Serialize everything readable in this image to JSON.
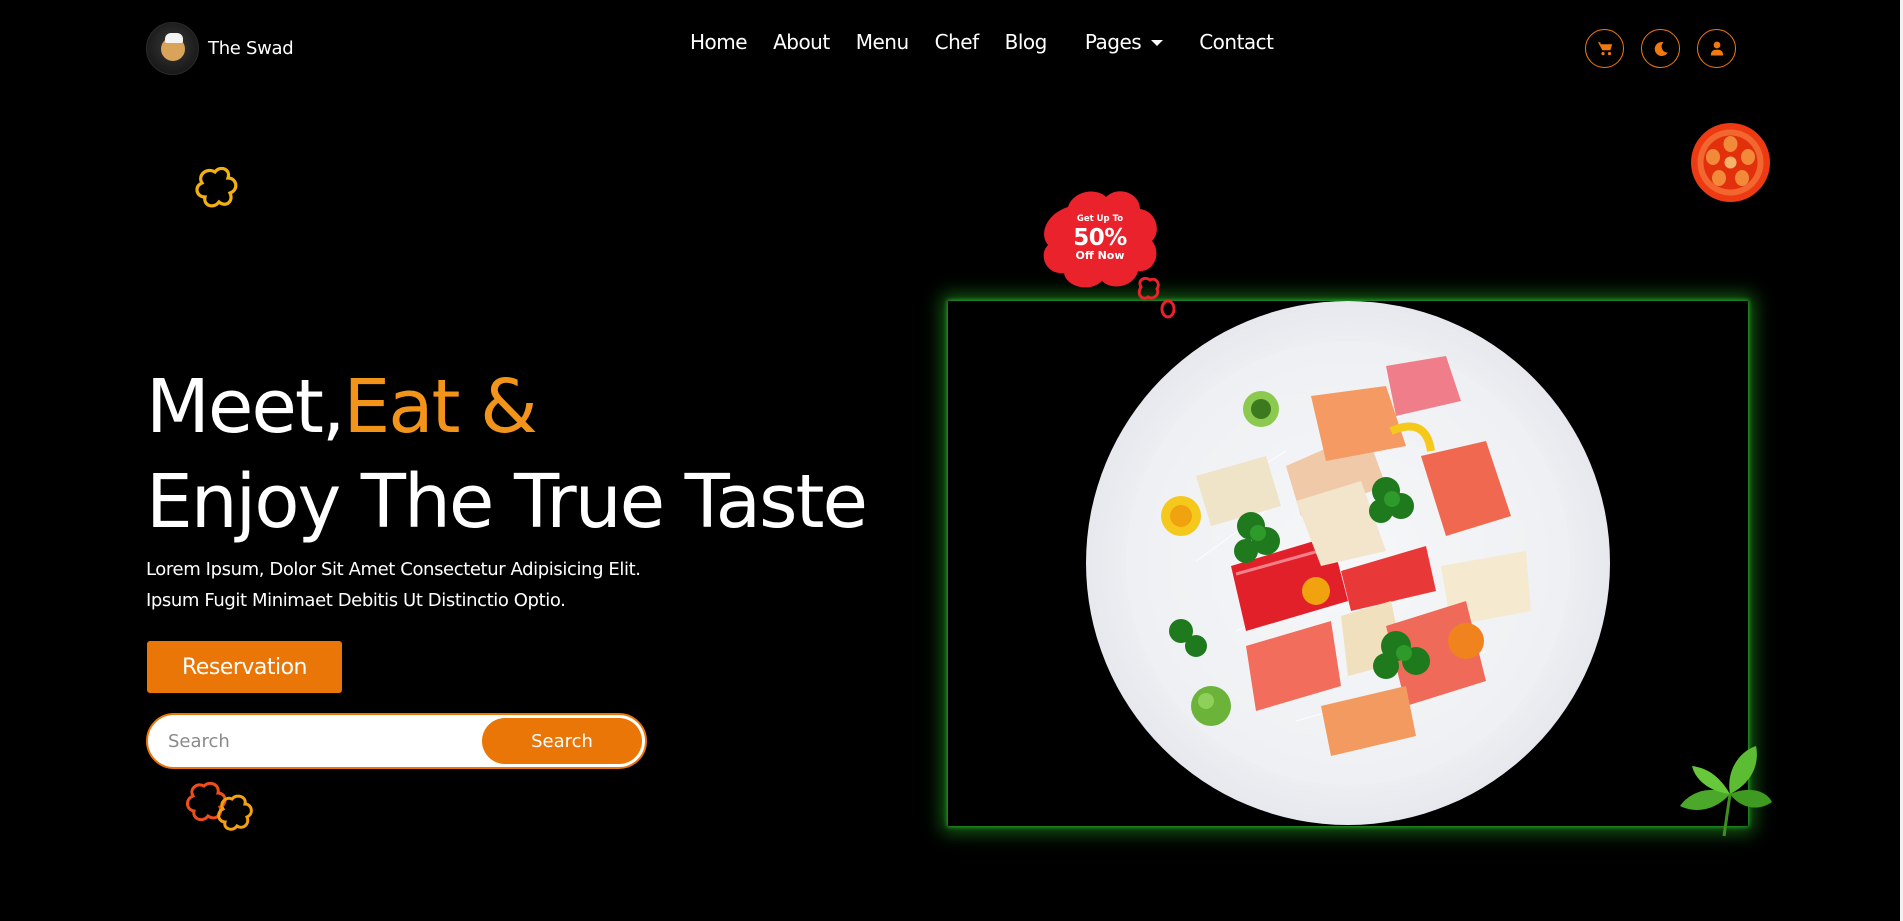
{
  "brand": {
    "name": "The Swad"
  },
  "nav": {
    "links": [
      "Home",
      "About",
      "Menu",
      "Chef",
      "Blog"
    ],
    "pages_label": "Pages",
    "contact_label": "Contact"
  },
  "nav_icons": [
    "cart-icon",
    "moon-icon",
    "user-icon"
  ],
  "hero": {
    "title_part1": "Meet,",
    "title_accent": "Eat &",
    "title_line2": "Enjoy The True Taste",
    "text_line1": "Lorem Ipsum, Dolor Sit Amet Consectetur Adipisicing Elit.",
    "text_line2": "Ipsum Fugit Minimaet Debitis Ut Distinctio Optio.",
    "reservation_label": "Reservation"
  },
  "search": {
    "placeholder": "Search",
    "value": "",
    "button_label": "Search"
  },
  "badge": {
    "top": "Get Up To",
    "big": "50%",
    "bottom": "Off Now"
  },
  "colors": {
    "accent": "#ea7608",
    "accent_text": "#f3941a",
    "background": "#000000",
    "badge_red": "#e9222b",
    "glow_green": "#24b424"
  }
}
